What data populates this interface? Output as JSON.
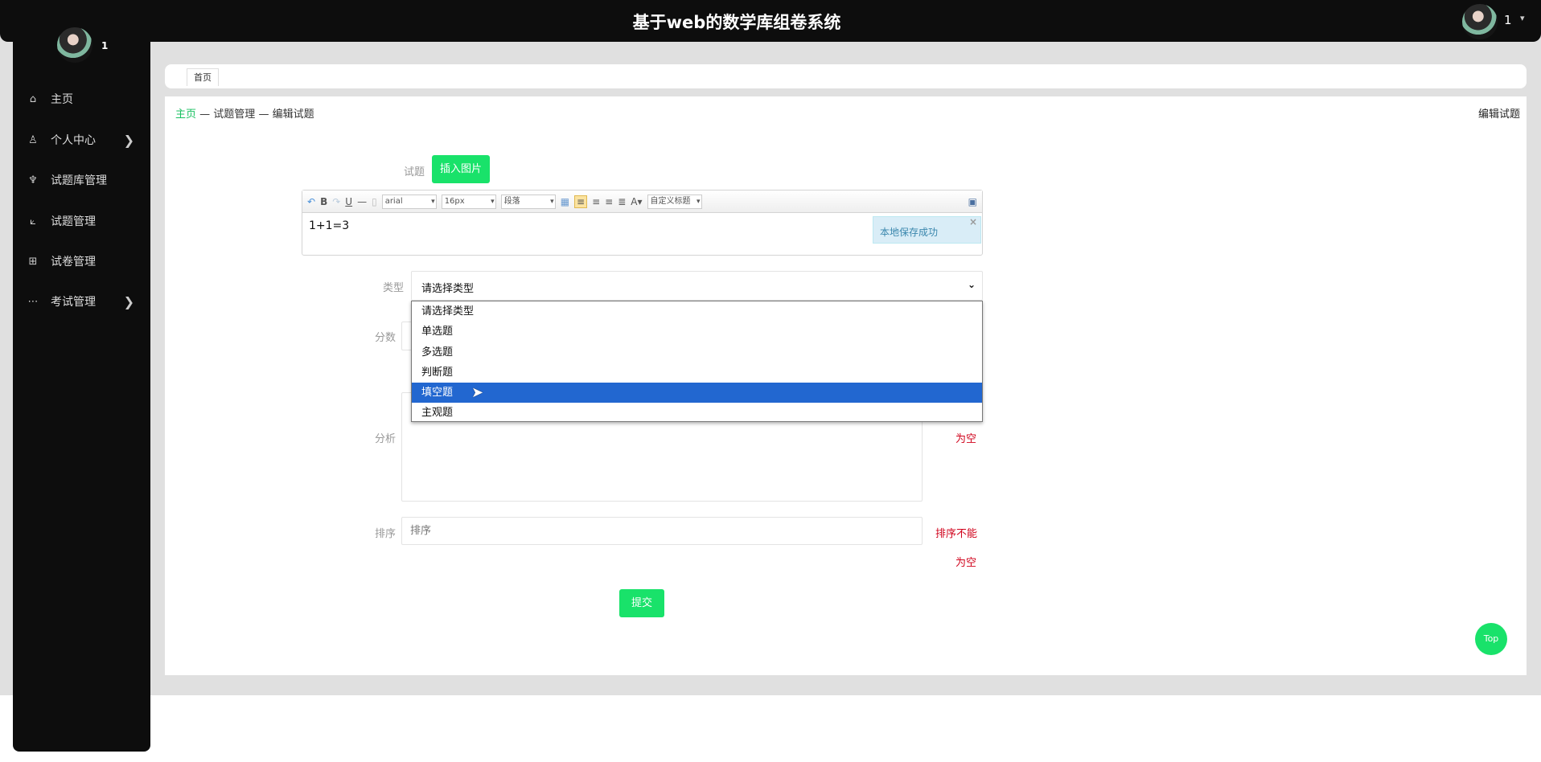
{
  "header": {
    "title": "基于web的数学库组卷系统",
    "user": "1"
  },
  "sidebar": {
    "user": "1",
    "items": [
      {
        "label": "主页",
        "icon": "home-icon",
        "chevron": false
      },
      {
        "label": "个人中心",
        "icon": "user-icon",
        "chevron": true
      },
      {
        "label": "试题库管理",
        "icon": "trophy-icon",
        "chevron": false
      },
      {
        "label": "试题管理",
        "icon": "chart-icon",
        "chevron": false
      },
      {
        "label": "试卷管理",
        "icon": "plus-square-icon",
        "chevron": false
      },
      {
        "label": "考试管理",
        "icon": "ellipsis-icon",
        "chevron": true
      }
    ]
  },
  "tabs": [
    "首页"
  ],
  "breadcrumb": {
    "home": "主页",
    "sep": "—",
    "level1": "试题管理",
    "level2": "编辑试题"
  },
  "page_title": "编辑试题",
  "form": {
    "question_label": "试题",
    "insert_image": "插入图片",
    "editor": {
      "font": "arial",
      "size": "16px",
      "paragraph": "段落",
      "custom_title": "自定义标题",
      "content": "1+1=3",
      "notice": "本地保存成功",
      "notice_close": "×"
    },
    "type_label": "类型",
    "type_value": "请选择类型",
    "type_options": [
      "请选择类型",
      "单选题",
      "多选题",
      "判断题",
      "填空题",
      "主观题"
    ],
    "type_highlighted": "填空题",
    "score_label": "分数",
    "analysis_label": "分析",
    "analysis_error": "为空",
    "sort_label": "排序",
    "sort_placeholder": "排序",
    "sort_error_1": "排序不能",
    "sort_error_2": "为空",
    "submit": "提交"
  },
  "top_button": "Top",
  "colors": {
    "accent": "#19e26a",
    "error": "#d0021b",
    "highlight": "#2267d0",
    "dark": "#0d0d0d"
  }
}
